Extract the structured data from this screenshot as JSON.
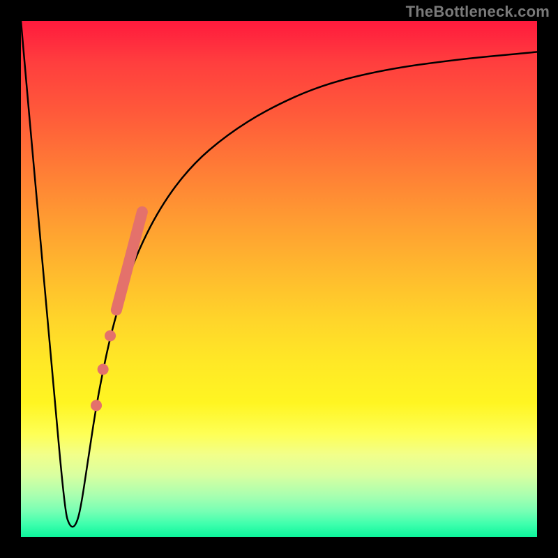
{
  "attribution": "TheBottleneck.com",
  "chart_data": {
    "type": "line",
    "title": "",
    "xlabel": "",
    "ylabel": "",
    "xlim": [
      0,
      100
    ],
    "ylim": [
      0,
      100
    ],
    "gradient_stops": [
      {
        "pos": 0,
        "color": "#ff1a3d"
      },
      {
        "pos": 8,
        "color": "#ff3e3e"
      },
      {
        "pos": 18,
        "color": "#ff5a3a"
      },
      {
        "pos": 28,
        "color": "#ff7a36"
      },
      {
        "pos": 38,
        "color": "#ff9a32"
      },
      {
        "pos": 48,
        "color": "#ffb82e"
      },
      {
        "pos": 58,
        "color": "#ffd52a"
      },
      {
        "pos": 66,
        "color": "#ffe826"
      },
      {
        "pos": 74,
        "color": "#fff522"
      },
      {
        "pos": 80,
        "color": "#feff55"
      },
      {
        "pos": 84,
        "color": "#f2ff8a"
      },
      {
        "pos": 88,
        "color": "#d9ffa0"
      },
      {
        "pos": 92,
        "color": "#a8ffb0"
      },
      {
        "pos": 95,
        "color": "#77ffb4"
      },
      {
        "pos": 97.5,
        "color": "#3effad"
      },
      {
        "pos": 100,
        "color": "#0cf59c"
      }
    ],
    "series": [
      {
        "name": "bottleneck-curve",
        "x": [
          0,
          3,
          6,
          8.5,
          9.5,
          10.5,
          11.5,
          13,
          15,
          18,
          22,
          27,
          33,
          40,
          48,
          58,
          70,
          84,
          100
        ],
        "y": [
          100,
          66,
          33,
          5,
          2,
          2,
          5,
          15,
          28,
          42,
          54,
          64,
          72,
          78,
          83,
          87.5,
          90.5,
          92.5,
          94
        ]
      }
    ],
    "highlight_bar": {
      "name": "red-segment",
      "color": "#e4716b",
      "x": [
        18.5,
        23.5
      ],
      "y": [
        44,
        63
      ]
    },
    "highlight_dots": {
      "name": "red-dots",
      "color": "#e4716b",
      "points": [
        {
          "x": 17.3,
          "y": 39
        },
        {
          "x": 15.9,
          "y": 32.5
        },
        {
          "x": 14.6,
          "y": 25.5
        }
      ]
    }
  }
}
